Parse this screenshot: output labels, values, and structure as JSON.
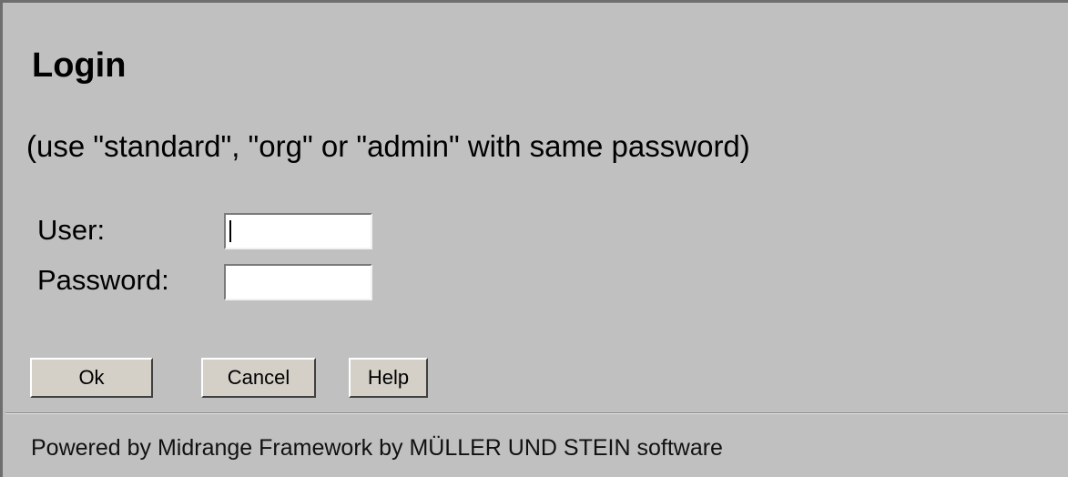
{
  "login": {
    "title": "Login",
    "hint": "(use \"standard\", \"org\" or \"admin\" with same password)",
    "user_label": "User:",
    "password_label": "Password:",
    "user_value": "",
    "password_value": ""
  },
  "buttons": {
    "ok_label": "Ok",
    "cancel_label": "Cancel",
    "help_label": "Help"
  },
  "footer": {
    "text": "Powered by Midrange Framework by MÜLLER UND STEIN software"
  },
  "colors": {
    "background": "#c0c0c0",
    "input_background": "#ffffff",
    "button_face": "#d4d0c8"
  }
}
